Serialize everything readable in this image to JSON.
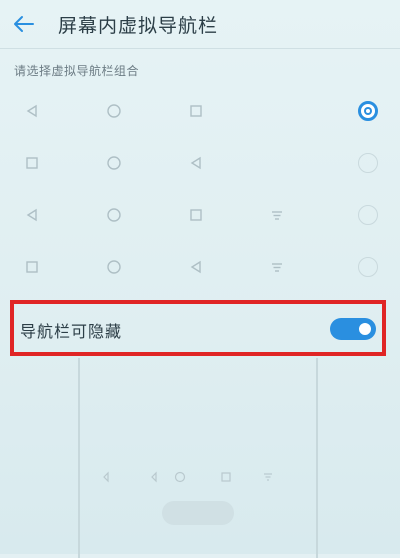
{
  "header": {
    "title": "屏幕内虚拟导航栏"
  },
  "section": {
    "label": "请选择虚拟导航栏组合"
  },
  "nav_combinations": [
    {
      "buttons": [
        "back-triangle-icon",
        "home-circle-icon",
        "recent-square-icon"
      ],
      "selected": true
    },
    {
      "buttons": [
        "recent-square-icon",
        "home-circle-icon",
        "back-triangle-icon"
      ],
      "selected": false
    },
    {
      "buttons": [
        "back-triangle-icon",
        "home-circle-icon",
        "recent-square-icon",
        "notification-pull-icon"
      ],
      "selected": false
    },
    {
      "buttons": [
        "recent-square-icon",
        "home-circle-icon",
        "back-triangle-icon",
        "notification-pull-icon"
      ],
      "selected": false
    }
  ],
  "hide_toggle": {
    "label": "导航栏可隐藏",
    "on": true
  },
  "colors": {
    "accent": "#2a8fe0",
    "highlight_border": "#e02525",
    "background": "#e3f0f3"
  }
}
